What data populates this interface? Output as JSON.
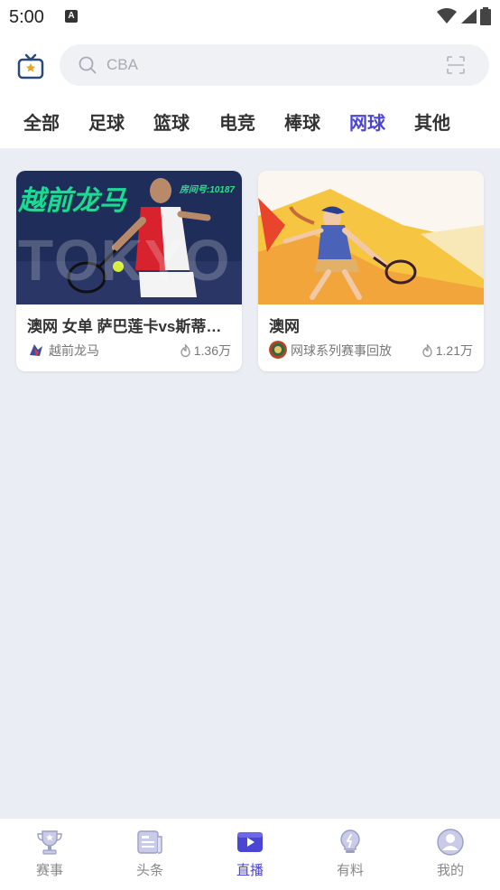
{
  "status_bar": {
    "time": "5:00",
    "notification_glyph": "A"
  },
  "search": {
    "placeholder": "CBA"
  },
  "tabs": [
    {
      "label": "全部"
    },
    {
      "label": "足球"
    },
    {
      "label": "篮球"
    },
    {
      "label": "电竞"
    },
    {
      "label": "棒球"
    },
    {
      "label": "网球",
      "active": true
    },
    {
      "label": "其他"
    }
  ],
  "cards": [
    {
      "title": "澳网 女单 萨巴莲卡vs斯蒂…",
      "author": "越前龙马",
      "heat": "1.36万",
      "thumb_text": "越前龙马",
      "thumb_room": "房间号:10187",
      "thumb_bg": "TOKYO"
    },
    {
      "title": "澳网",
      "author": "网球系列赛事回放",
      "heat": "1.21万"
    }
  ],
  "bottom_nav": [
    {
      "label": "赛事",
      "icon": "trophy-icon"
    },
    {
      "label": "头条",
      "icon": "news-icon"
    },
    {
      "label": "直播",
      "icon": "play-icon",
      "active": true
    },
    {
      "label": "有料",
      "icon": "bulb-icon"
    },
    {
      "label": "我的",
      "icon": "user-icon"
    }
  ],
  "colors": {
    "accent": "#4a45d4",
    "background": "#eaedf3"
  }
}
